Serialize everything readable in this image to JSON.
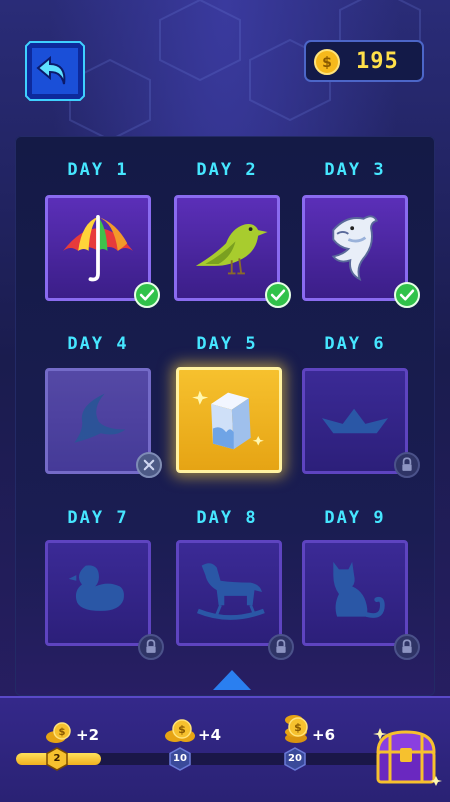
{
  "header": {
    "coins": "195",
    "icons": [
      "back-arrow-icon",
      "coin-icon"
    ]
  },
  "days": [
    {
      "label": "DAY 1",
      "state": "collected",
      "item": "umbrella-icon"
    },
    {
      "label": "DAY 2",
      "state": "collected",
      "item": "bird-icon"
    },
    {
      "label": "DAY 3",
      "state": "collected",
      "item": "dolphin-icon"
    },
    {
      "label": "DAY 4",
      "state": "missed",
      "item": "fidget-spinner-icon"
    },
    {
      "label": "DAY 5",
      "state": "today",
      "item": "milk-carton-icon"
    },
    {
      "label": "DAY 6",
      "state": "locked",
      "item": "paper-boat-icon"
    },
    {
      "label": "DAY 7",
      "state": "locked",
      "item": "rubber-duck-icon"
    },
    {
      "label": "DAY 8",
      "state": "locked",
      "item": "rocking-horse-icon"
    },
    {
      "label": "DAY 9",
      "state": "locked",
      "item": "cat-icon"
    }
  ],
  "rewards": {
    "bonuses": [
      "+2",
      "+4",
      "+6"
    ],
    "milestones": [
      "2",
      "10",
      "20"
    ],
    "progress": 0.23
  },
  "colors": {
    "accent": "#46e6ff",
    "gold": "#f6c12e",
    "check": "#31c24a"
  }
}
